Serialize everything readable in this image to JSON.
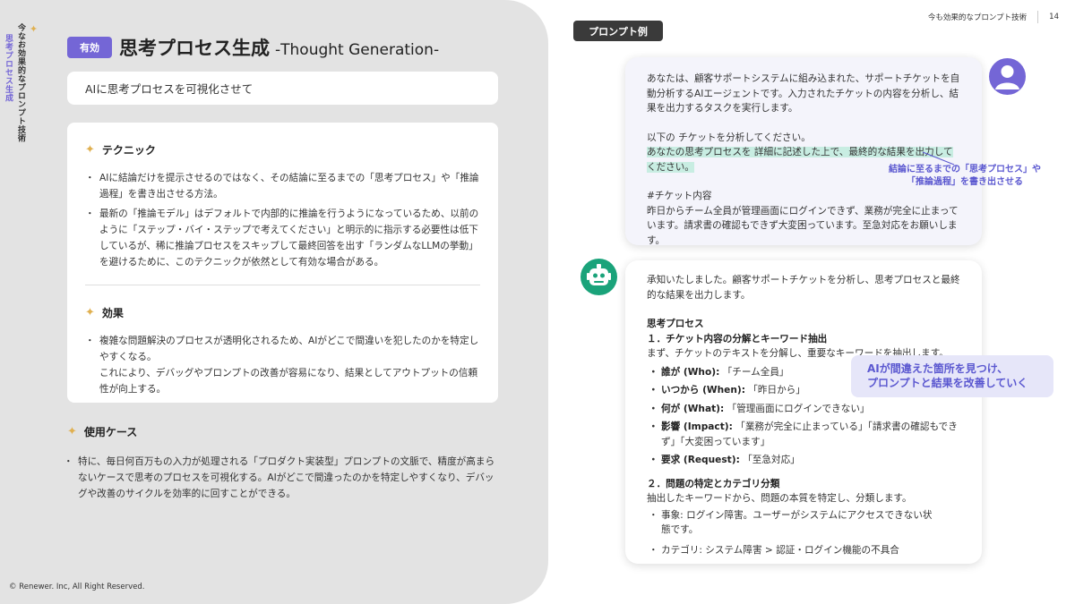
{
  "sidebar": {
    "vertical_title": "今なお効果的なプロンプト技術",
    "vertical_subtitle": "思考プロセス生成"
  },
  "header": {
    "badge": "有効",
    "title": "思考プロセス生成",
    "title_en": "-Thought Generation-",
    "page_section": "今も効果的なプロンプト技術",
    "page_number": "14"
  },
  "summary": "AIに思考プロセスを可視化させて",
  "technique": {
    "heading": "テクニック",
    "bullets": [
      "AIに結論だけを提示させるのではなく、その結論に至るまでの「思考プロセス」や「推論過程」を書き出させる方法。",
      "最新の「推論モデル」はデフォルトで内部的に推論を行うようになっているため、以前のように「ステップ・バイ・ステップで考えてください」と明示的に指示する必要性は低下しているが、稀に推論プロセスをスキップして最終回答を出す「ランダムなLLMの挙動」を避けるために、このテクニックが依然として有効な場合がある。"
    ]
  },
  "effect": {
    "heading": "効果",
    "bullets": [
      "複雑な問題解決のプロセスが透明化されるため、AIがどこで間違いを犯したのかを特定しやすくなる。\nこれにより、デバッグやプロンプトの改善が容易になり、結果としてアウトプットの信頼性が向上する。"
    ]
  },
  "usecase": {
    "heading": "使用ケース",
    "bullets": [
      "特に、毎日何百万もの入力が処理される「プロダクト実装型」プロンプトの文脈で、精度が高まらないケースで思考のプロセスを可視化する。AIがどこで間違ったのかを特定しやすくなり、デバッグや改善のサイクルを効率的に回すことができる。"
    ]
  },
  "copyright": "© Renewer. Inc, All Right Reserved.",
  "prompt_tag": "プロンプト例",
  "user_bubble": {
    "p1": "あなたは、顧客サポートシステムに組み込まれた、サポートチケットを自動分析するAIエージェントです。入力されたチケットの内容を分析し、結果を出力するタスクを実行します。",
    "p2": "以下の チケットを分析してください。",
    "highlight": "あなたの思考プロセスを 詳細に記述した上で、最終的な結果を出力してください。",
    "p3_label": "#チケット内容",
    "p3": "昨日からチーム全員が管理画面にログインできず、業務が完全に止まっています。請求書の確認もできず大変困っています。至急対応をお願いします。"
  },
  "note_blue": "結論に至るまでの「思考プロセス」や\n「推論過程」を書き出させる",
  "ai_bubble": {
    "intro": "承知いたしました。顧客サポートチケットを分析し、思考プロセスと最終的な結果を出力します。",
    "process_title": "思考プロセス",
    "step1_title": "１．チケット内容の分解とキーワード抽出",
    "step1_text": "まず、チケットのテキストを分解し、重要なキーワードを抽出します。",
    "keywords": [
      {
        "key": "誰が (Who):",
        "val": " 「チーム全員」"
      },
      {
        "key": "いつから (When):",
        "val": " 「昨日から」"
      },
      {
        "key": "何が (What):",
        "val": " 「管理画面にログインできない」"
      },
      {
        "key": "影響 (Impact):",
        "val": " 「業務が完全に止まっている」「請求書の確認もできず」「大変困っています」"
      },
      {
        "key": "要求 (Request):",
        "val": " 「至急対応」"
      }
    ],
    "step2_title": "２．問題の特定とカテゴリ分類",
    "step2_text": "抽出したキーワードから、問題の本質を特定し、分類します。",
    "step2_items": [
      "事象: ログイン障害。ユーザーがシステムにアクセスできない状\n態です。",
      "カテゴリ: システム障害 > 認証・ログイン機能の不具合"
    ]
  },
  "callout": "AIが間違えた箇所を見つけ、\nプロンプトと結果を改善していく",
  "colors": {
    "accent": "#7466d6",
    "bot": "#1aa37a",
    "highlight": "#c8ede2",
    "callout_text": "#5b58d0"
  },
  "icons": {
    "user_avatar": "user-icon",
    "bot_avatar": "robot-icon",
    "sparkle": "sparkle-icon"
  }
}
